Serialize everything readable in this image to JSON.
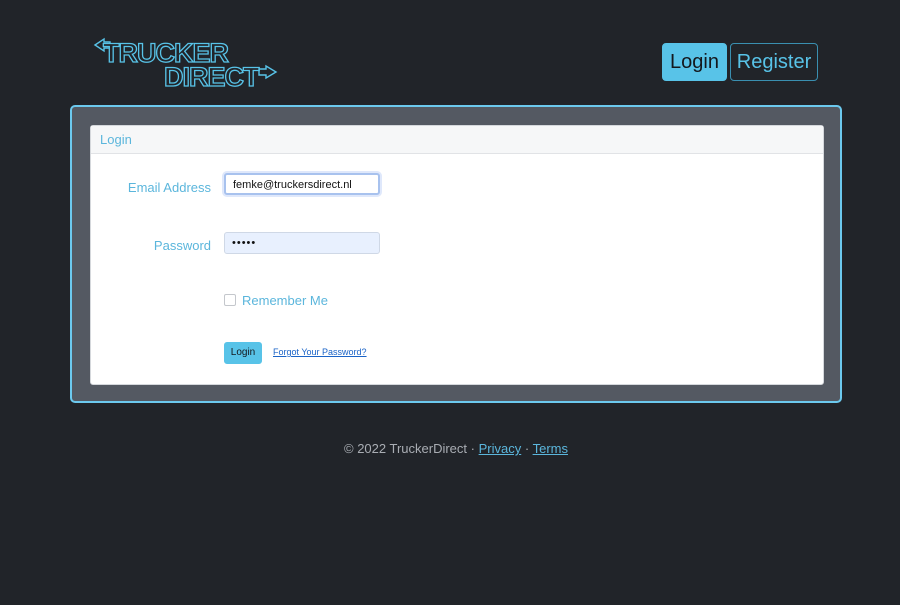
{
  "header": {
    "logo": {
      "line1": "TRUCKER",
      "line2": "DIRECT",
      "accent": "#58c3e8"
    },
    "nav": {
      "login_label": "Login",
      "register_label": "Register"
    }
  },
  "login_card": {
    "title": "Login",
    "email": {
      "label": "Email Address",
      "value": "femke@truckersdirect.nl"
    },
    "password": {
      "label": "Password",
      "masked_value": "•••••"
    },
    "remember": {
      "label": "Remember Me",
      "checked": false
    },
    "submit_label": "Login",
    "forgot_label": "Forgot Your Password?"
  },
  "footer": {
    "copyright": "© 2022 TruckerDirect",
    "separator": "·",
    "privacy_label": "Privacy",
    "terms_label": "Terms"
  },
  "colors": {
    "background": "#212429",
    "accent": "#58c3e8",
    "panel": "#545962",
    "link": "#1a63c7"
  }
}
